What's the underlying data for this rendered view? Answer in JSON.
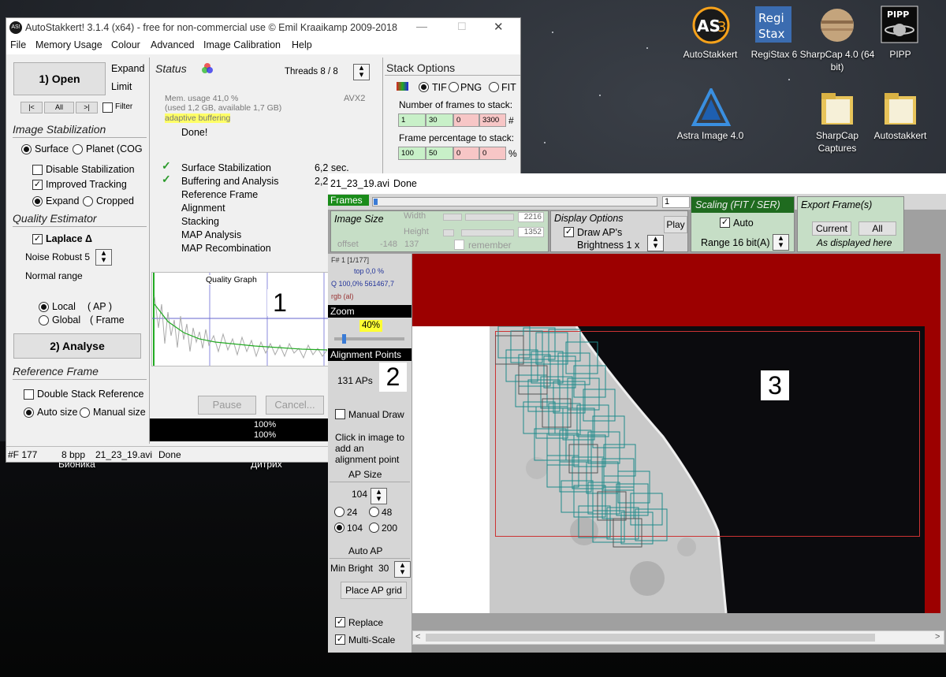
{
  "desktop": {
    "icons": [
      {
        "label": "AutoStakkert",
        "icon": "as3-icon"
      },
      {
        "label": "RegiStax 6",
        "icon": "registax-icon"
      },
      {
        "label": "SharpCap 4.0 (64 bit)",
        "icon": "sharpcap-icon"
      },
      {
        "label": "PIPP",
        "icon": "pipp-icon"
      },
      {
        "label": "Astra Image 4.0",
        "icon": "astra-icon"
      },
      {
        "label": "SharpCap Captures",
        "icon": "folder-icon"
      },
      {
        "label": "Autostakkert",
        "icon": "folder-icon"
      }
    ],
    "bg_labels": [
      "Бионика",
      "Дитрих"
    ]
  },
  "main": {
    "title": "AutoStakkert! 3.1.4 (x64) - free for non-commercial use © Emil Kraaikamp 2009-2018",
    "menu": [
      "File",
      "Memory Usage",
      "Colour",
      "Advanced",
      "Image Calibration",
      "Help"
    ],
    "open_btn": "1) Open",
    "expand": "Expand",
    "limit": "Limit",
    "nav": [
      "|<",
      "All",
      ">|"
    ],
    "filter": "Filter",
    "stab_header": "Image Stabilization",
    "surface": "Surface",
    "planet": "Planet (COG",
    "disable_stab": "Disable Stabilization",
    "improved_tracking": "Improved Tracking",
    "expand2": "Expand",
    "cropped": "Cropped",
    "quality_header": "Quality Estimator",
    "laplace": "Laplace Δ",
    "noise_robust": "Noise Robust 5",
    "normal_range": "Normal range",
    "local": "Local",
    "local_ap": "( AP )",
    "global": "Global",
    "global_frame": "( Frame",
    "analyse_btn": "2) Analyse",
    "ref_header": "Reference Frame",
    "double_stack": "Double Stack Reference",
    "auto_size": "Auto size",
    "manual_size": "Manual size",
    "status_header": "Status",
    "threads": "Threads 8 / 8",
    "mem_line1": "Mem. usage 41,0 %",
    "mem_line2": "(used 1,2 GB, available 1,7 GB)",
    "avx": "AVX2",
    "adaptive": "adaptive buffering",
    "done": "Done!",
    "steps": [
      {
        "label": "Surface Stabilization",
        "time": "6,2 sec.",
        "checked": true
      },
      {
        "label": "Buffering and Analysis",
        "time": "2,2",
        "checked": true
      },
      {
        "label": "Reference Frame",
        "time": "",
        "checked": false
      },
      {
        "label": "Alignment",
        "time": "",
        "checked": false
      },
      {
        "label": "Stacking",
        "time": "",
        "checked": false
      },
      {
        "label": "MAP Analysis",
        "time": "",
        "checked": false
      },
      {
        "label": "MAP Recombination",
        "time": "",
        "checked": false
      }
    ],
    "quality_graph": "Quality Graph",
    "annot1": "1",
    "pause": "Pause",
    "cancel": "Cancel...",
    "progress1": "100%",
    "progress2": "100%",
    "stack_header": "Stack Options",
    "tif": "TIF",
    "png": "PNG",
    "fit": "FIT",
    "nframes_label": "Number of frames to stack:",
    "nframes": [
      "1",
      "30",
      "0",
      "3300"
    ],
    "hash": "#",
    "fpct_label": "Frame percentage to stack:",
    "fpct": [
      "100",
      "50",
      "0",
      "0"
    ],
    "pct": "%",
    "status_bar": [
      "#F 177",
      "8 bpp",
      "21_23_19.avi",
      "Done"
    ]
  },
  "avi": {
    "title": "21_23_19.avi",
    "title_status": "Done",
    "frames_label": "Frames",
    "frame_input": "1",
    "image_size": "Image Size",
    "width_lbl": "Width",
    "width_val": "2216",
    "height_lbl": "Height",
    "height_val": "1352",
    "offset_lbl": "offset",
    "offset_x": "-148",
    "offset_y": "137",
    "remember": "remember",
    "display_options": "Display Options",
    "draw_aps": "Draw AP's",
    "brightness": "Brightness 1 x",
    "play": "Play",
    "scaling": "Scaling (FIT / SER)",
    "auto": "Auto",
    "range": "Range 16 bit(A)",
    "export": "Export Frame(s)",
    "current": "Current",
    "all": "All",
    "as_displayed": "As displayed here",
    "frame_info": "F# 1 [1/177]",
    "top_info": "top 0,0 %",
    "q_info": "Q 100,0%  561467,7",
    "rgb_info": "rgb (al)",
    "zoom_lbl": "Zoom",
    "zoom_val": "40%",
    "ap_header": "Alignment Points",
    "ap_count": "131 APs",
    "annot2": "2",
    "manual_draw": "Manual Draw",
    "click_hint": "Click in image to add an alignment point",
    "ap_size": "AP Size",
    "ap_size_val": "104",
    "sizes": [
      "24",
      "48",
      "104",
      "200"
    ],
    "auto_ap": "Auto AP",
    "min_bright": "Min Bright",
    "min_bright_val": "30",
    "place_grid": "Place AP grid",
    "replace": "Replace",
    "multi_scale": "Multi-Scale",
    "annot3": "3"
  },
  "colors": {
    "dark_red": "#9c0000",
    "green_panel": "#c6dec6",
    "ap_teal": "#1f8a8a"
  }
}
